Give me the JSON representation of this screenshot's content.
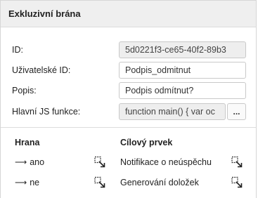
{
  "panel": {
    "title": "Exkluzivní brána"
  },
  "form": {
    "id_label": "ID:",
    "id_value": "5d0221f3-ce65-40f2-89b3",
    "user_id_label": "Uživatelské ID:",
    "user_id_value": "Podpis_odmitnut",
    "description_label": "Popis:",
    "description_value": "Podpis odmítnut?",
    "main_js_label": "Hlavní JS funkce:",
    "main_js_value": "function main() {  var oc",
    "main_js_button": "..."
  },
  "edges": {
    "col_edge": "Hrana",
    "col_target": "Cílový prvek",
    "arrow_glyph": "⟶",
    "rows": [
      {
        "edge": "ano",
        "target": "Notifikace o neúspěchu"
      },
      {
        "edge": "ne",
        "target": "Generování doložek"
      }
    ]
  },
  "icons": {
    "navigate_icon": "select-navigate-icon"
  }
}
